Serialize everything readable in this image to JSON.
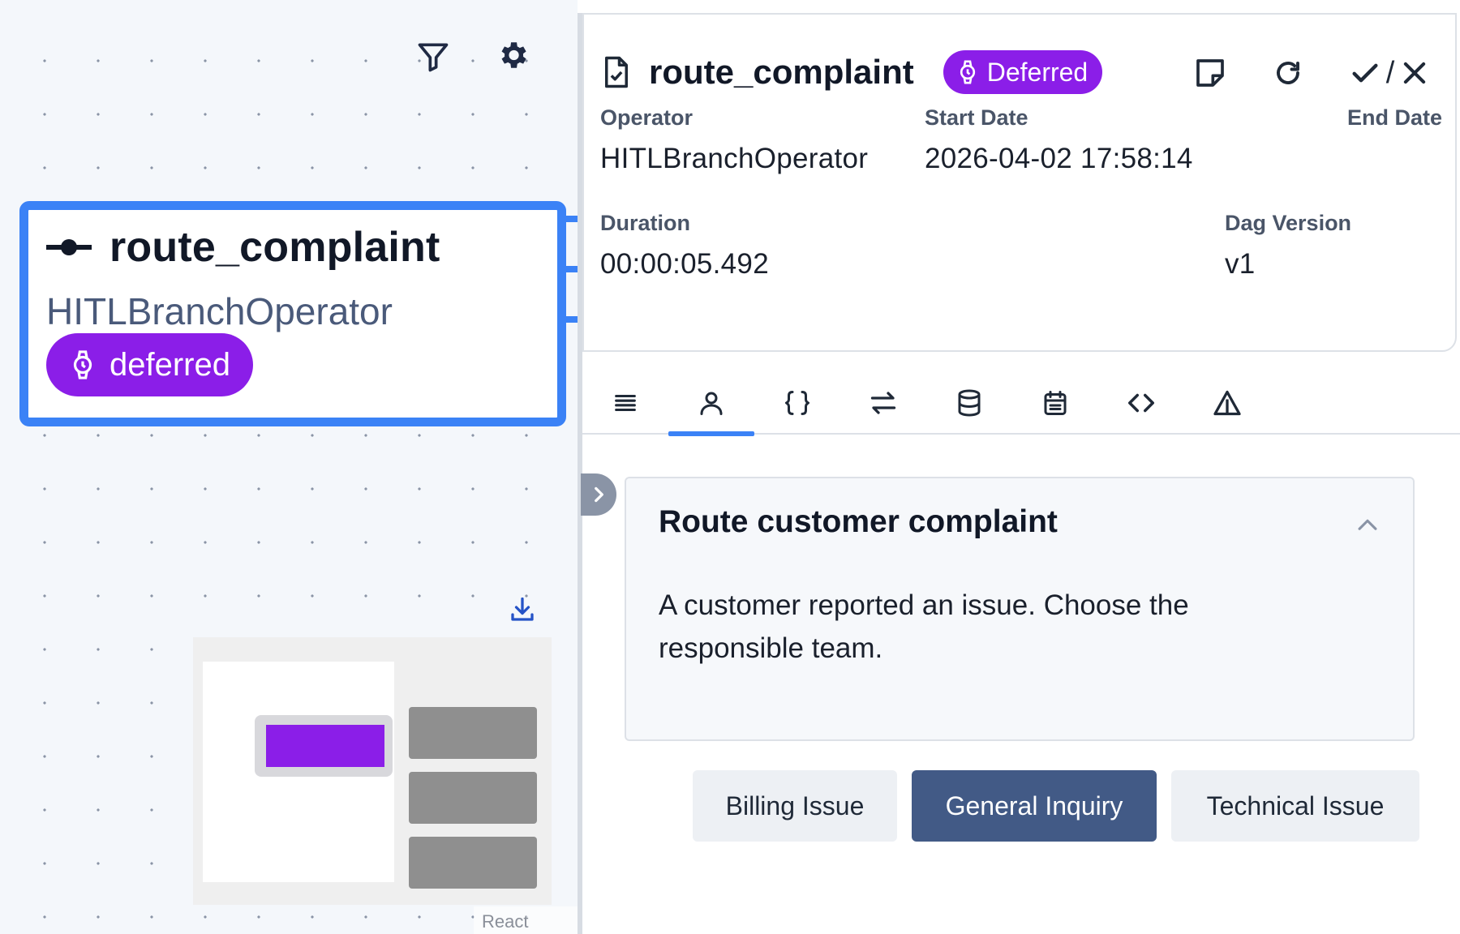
{
  "graph": {
    "node": {
      "title": "route_complaint",
      "operator": "HITLBranchOperator",
      "state": "deferred",
      "icon": "commit-node-icon"
    },
    "toolbar": {
      "filter_icon": "filter-icon",
      "settings_icon": "gear-icon",
      "download_icon": "download-icon"
    },
    "attribution": "React Flow",
    "colors": {
      "selected_border": "#3b82f6",
      "deferred": "#8b1ee8"
    }
  },
  "details": {
    "task_id": "route_complaint",
    "state_badge": "Deferred",
    "actions": {
      "note_icon": "sticky-note-icon",
      "clear_icon": "refresh-icon",
      "mark_as_separator": "/"
    },
    "fields": {
      "operator_label": "Operator",
      "operator_value": "HITLBranchOperator",
      "start_label": "Start Date",
      "start_value": "2026-04-02 17:58:14",
      "end_label": "End Date",
      "end_value": "",
      "duration_label": "Duration",
      "duration_value": "00:00:05.492",
      "dag_version_label": "Dag Version",
      "dag_version_value": "v1"
    },
    "tabs": [
      {
        "icon": "logs-icon"
      },
      {
        "icon": "user-icon",
        "active": true
      },
      {
        "icon": "braces-icon"
      },
      {
        "icon": "arrows-swap-icon"
      },
      {
        "icon": "database-icon"
      },
      {
        "icon": "calendar-icon"
      },
      {
        "icon": "code-icon"
      },
      {
        "icon": "warning-icon"
      }
    ]
  },
  "hitl": {
    "subject": "Route customer complaint",
    "body": "A customer reported an issue. Choose the responsible team.",
    "options": [
      "Billing Issue",
      "General Inquiry",
      "Technical Issue"
    ],
    "selected_option": "General Inquiry"
  }
}
